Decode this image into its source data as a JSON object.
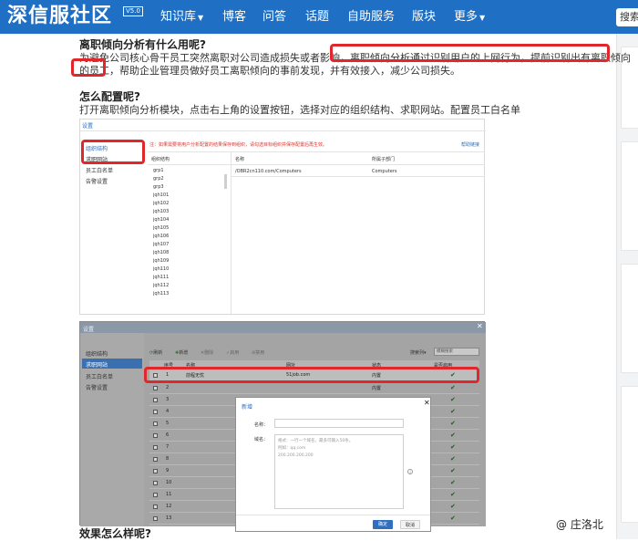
{
  "site": {
    "name": "深信服社区",
    "badge": "V5.0"
  },
  "nav": {
    "items": [
      {
        "label": "知识库",
        "dropdown": true
      },
      {
        "label": "博客",
        "dropdown": false
      },
      {
        "label": "问答",
        "dropdown": false
      },
      {
        "label": "话题",
        "dropdown": false
      },
      {
        "label": "自助服务",
        "dropdown": false
      },
      {
        "label": "版块",
        "dropdown": false
      },
      {
        "label": "更多",
        "dropdown": true
      }
    ],
    "search_label": "搜索"
  },
  "article": {
    "heading1": "离职倾向分析有什么用呢?",
    "para1_line1": "为避免公司核心骨干员工突然离职对公司造成损失或者影响，离职倾向分析通过识别用户的上网行为，提前识别出有离职倾向",
    "para1_line2": "的员工，帮助企业管理员做好员工离职倾向的事前发现，并有效接入，减少公司损失。",
    "heading2": "怎么配置呢?",
    "para2": "打开离职倾向分析模块，点击右上角的设置按钮，选择对应的组织结构、求职网站。配置员工白名单",
    "heading3": "效果怎么样呢?"
  },
  "shot1": {
    "title": "设置",
    "menu": [
      "组织结构",
      "求职网站",
      "员工白名单",
      "告警设置"
    ],
    "notice": "注：如果需要将用户分析配置的结果保存到组织，请勾选目标组织并保存配置后再生效。",
    "help_link": "帮助链接",
    "tree_header": "组织结构",
    "tree": [
      "grp1",
      "grp2",
      "grp3",
      "jqh101",
      "jqh102",
      "jqh103",
      "jqh104",
      "jqh105",
      "jqh106",
      "jqh107",
      "jqh108",
      "jqh109",
      "jqh110",
      "jqh111",
      "jqh112",
      "jqh113"
    ],
    "col_name": "名称",
    "col_dept": "所属子部门",
    "row_name": "/OBR2cn110.com/Computers",
    "row_dept": "Computers"
  },
  "shot2": {
    "title": "设置",
    "menu": [
      "组织结构",
      "求职网站",
      "员工白名单",
      "告警设置"
    ],
    "toolbar": [
      "刷新",
      "新增",
      "删除",
      "启用",
      "禁用"
    ],
    "search_by": "搜索列",
    "search_placeholder": "模糊搜索",
    "col_no": "序号",
    "col_name": "名称",
    "col_url": "网址",
    "col_status": "状态",
    "col_enable": "是否启用",
    "row1": {
      "no": "1",
      "name": "前程无忧",
      "url": "51job.com",
      "status": "内置"
    },
    "row_numbers": [
      "2",
      "3",
      "4",
      "5",
      "6",
      "7",
      "8",
      "9",
      "10",
      "11",
      "12",
      "13"
    ],
    "row_status": "内置",
    "modal": {
      "title": "新增",
      "name_label": "名称：",
      "url_label": "域名：",
      "placeholder_line1": "格式：一行一个域名，最多可输入50条。",
      "placeholder_line2": "例如：qq.com",
      "placeholder_line3": "200.200.200.200",
      "ok": "确定",
      "cancel": "取消"
    }
  },
  "watermark": "@ 庄洛北",
  "colors": {
    "nav": "#1f6fc5",
    "highlight": "#e0282c",
    "link": "#2a6ebd"
  }
}
